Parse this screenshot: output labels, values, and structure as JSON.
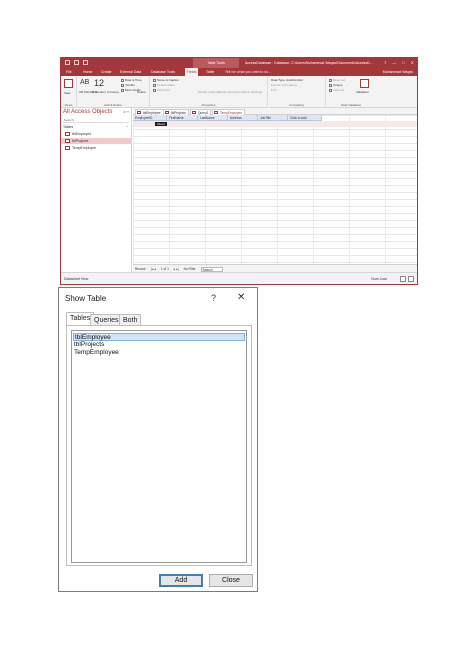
{
  "app": {
    "window_title": "AccessDatabase : Database- C:\\Users\\Muhammad Waqas\\Documents\\AccessD...",
    "contextual_tab_group": "Table Tools",
    "window_controls": [
      "?",
      "—",
      "□",
      "✕"
    ],
    "tabs": [
      "File",
      "Home",
      "Create",
      "External Data",
      "Database Tools",
      "Fields",
      "Table"
    ],
    "active_tab": "Fields",
    "tell_me": "Tell me what you want to do...",
    "user": "Muhammad Waqas",
    "accent_color": "#a4373a"
  },
  "ribbon": {
    "groups": [
      {
        "label": "Views",
        "buttons": [
          "View"
        ]
      },
      {
        "label": "Add & Delete",
        "buttons": [
          "AB Short Text",
          "12 Number",
          "Currency",
          "Date & Time",
          "Yes/No",
          "More Fields",
          "Delete"
        ]
      },
      {
        "label": "Properties",
        "buttons": [
          "Name & Caption",
          "Default Value",
          "Field Size",
          "Modify Lookups",
          "Modify Expression",
          "Memo Settings"
        ]
      },
      {
        "label": "Formatting",
        "buttons": [
          "Data Type: AutoNumber",
          "Format: Formatting",
          "$ % ,"
        ]
      },
      {
        "label": "Field Validation",
        "buttons": [
          "Required",
          "Unique",
          "Indexed",
          "Validation"
        ]
      }
    ],
    "number_glyph": "12",
    "ab_glyph": "AB"
  },
  "nav": {
    "title": "All Access Objects",
    "search_placeholder": "Search...",
    "section": "Tables",
    "items": [
      "tblEmployee",
      "tblProjects",
      "TempEmployee"
    ],
    "selected": "tblProjects"
  },
  "document": {
    "tabs": [
      "tblEmployee",
      "tblProjects",
      "Query1",
      "TempEmployee"
    ],
    "active_tab": "TempEmployee",
    "columns": [
      "EmployeeID",
      "FirstName",
      "LastName",
      "Address",
      "JobTitle",
      "Click to Add"
    ],
    "new_row_value": "(New)",
    "record_nav": {
      "label": "Record:",
      "position": "1 of 1",
      "filter": "No Filter",
      "search": "Search"
    }
  },
  "status": {
    "left": "Datasheet View",
    "right": "Num Lock"
  },
  "dialog": {
    "title": "Show Table",
    "help": "?",
    "close": "✕",
    "tabs": [
      "Tables",
      "Queries",
      "Both"
    ],
    "active_tab": "Tables",
    "list_items": [
      "tblEmployee",
      "tblProjects",
      "TempEmployee"
    ],
    "selected_item": "tblEmployee",
    "buttons": {
      "add": "Add",
      "close": "Close"
    },
    "selection_color": "#cde3f7"
  }
}
